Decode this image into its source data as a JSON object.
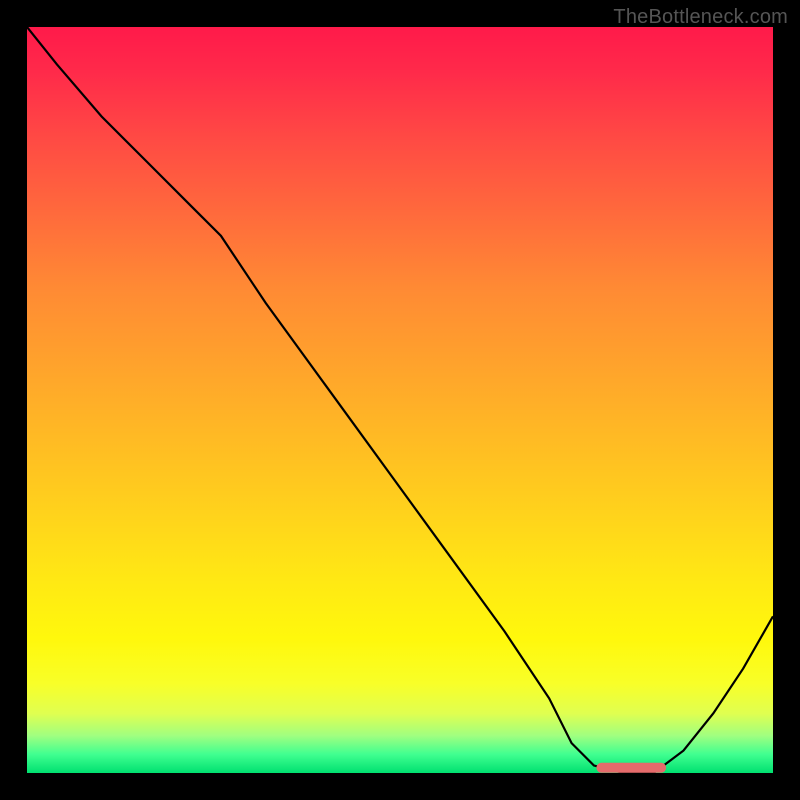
{
  "watermark": "TheBottleneck.com",
  "chart_data": {
    "type": "line",
    "title": "",
    "xlabel": "",
    "ylabel": "",
    "xlim": [
      0,
      100
    ],
    "ylim": [
      0,
      100
    ],
    "curve": {
      "name": "bottleneck-curve",
      "x": [
        0,
        4,
        10,
        16,
        22,
        26,
        32,
        40,
        48,
        56,
        64,
        70,
        73,
        76,
        80,
        84,
        88,
        92,
        96,
        100
      ],
      "y": [
        100,
        95,
        88,
        82,
        76,
        72,
        63,
        52,
        41,
        30,
        19,
        10,
        4,
        1,
        0,
        0,
        3,
        8,
        14,
        21
      ]
    },
    "marker": {
      "x_start": 77,
      "x_end": 85,
      "y": 0.7
    },
    "background_gradient": {
      "top": "#ff1a4a",
      "mid": "#ffd21c",
      "bottom": "#00e070"
    }
  }
}
